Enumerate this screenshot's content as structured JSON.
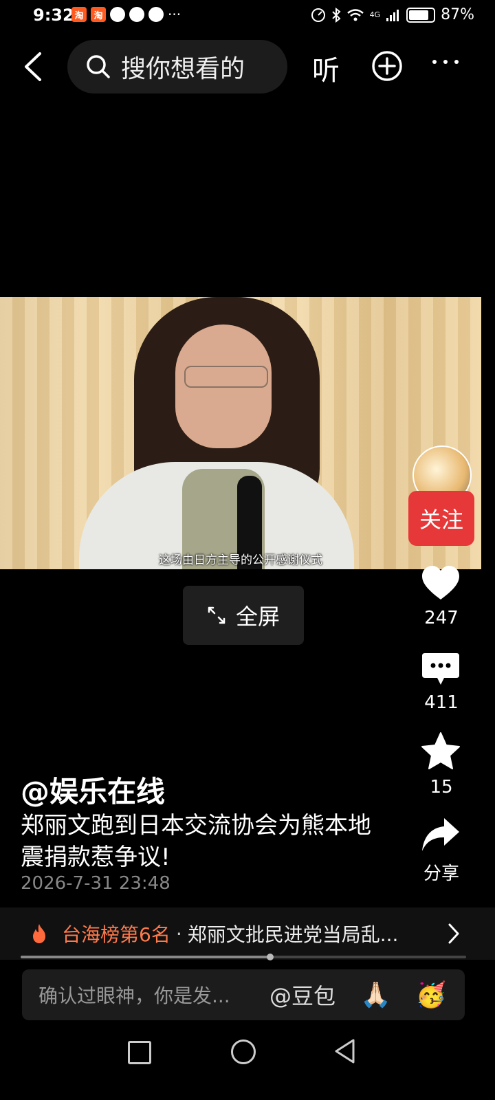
{
  "status_bar": {
    "time": "9:32",
    "app_badges": [
      "淘",
      "淘"
    ],
    "overflow": "···",
    "network": "4G",
    "battery": "87%"
  },
  "top_nav": {
    "search_placeholder": "搜你想看的",
    "listen_label": "听"
  },
  "video": {
    "subtitle": "这场由日方主导的公开感谢仪式",
    "fullscreen_label": "全屏"
  },
  "right_rail": {
    "follow_label": "关注",
    "likes": "247",
    "comments": "411",
    "favorites": "15",
    "share_label": "分享"
  },
  "post": {
    "author": "@娱乐在线",
    "title": "郑丽文跑到日本交流协会为熊本地震捐款惹争议!",
    "date": "2026-7-31 23:48"
  },
  "trending": {
    "rank": "台海榜第6名",
    "separator": "·",
    "headline": "郑丽文批民进党当局乱..."
  },
  "playback": {
    "progress_fraction": 0.56
  },
  "comment_bar": {
    "placeholder": "确认过眼神，你是发...",
    "mention": "@豆包",
    "emoji_1": "🙏🏻",
    "emoji_2": "🥳"
  },
  "colors": {
    "follow_red": "#e63838",
    "trend_orange": "#ff7a4a",
    "background": "#000000"
  }
}
